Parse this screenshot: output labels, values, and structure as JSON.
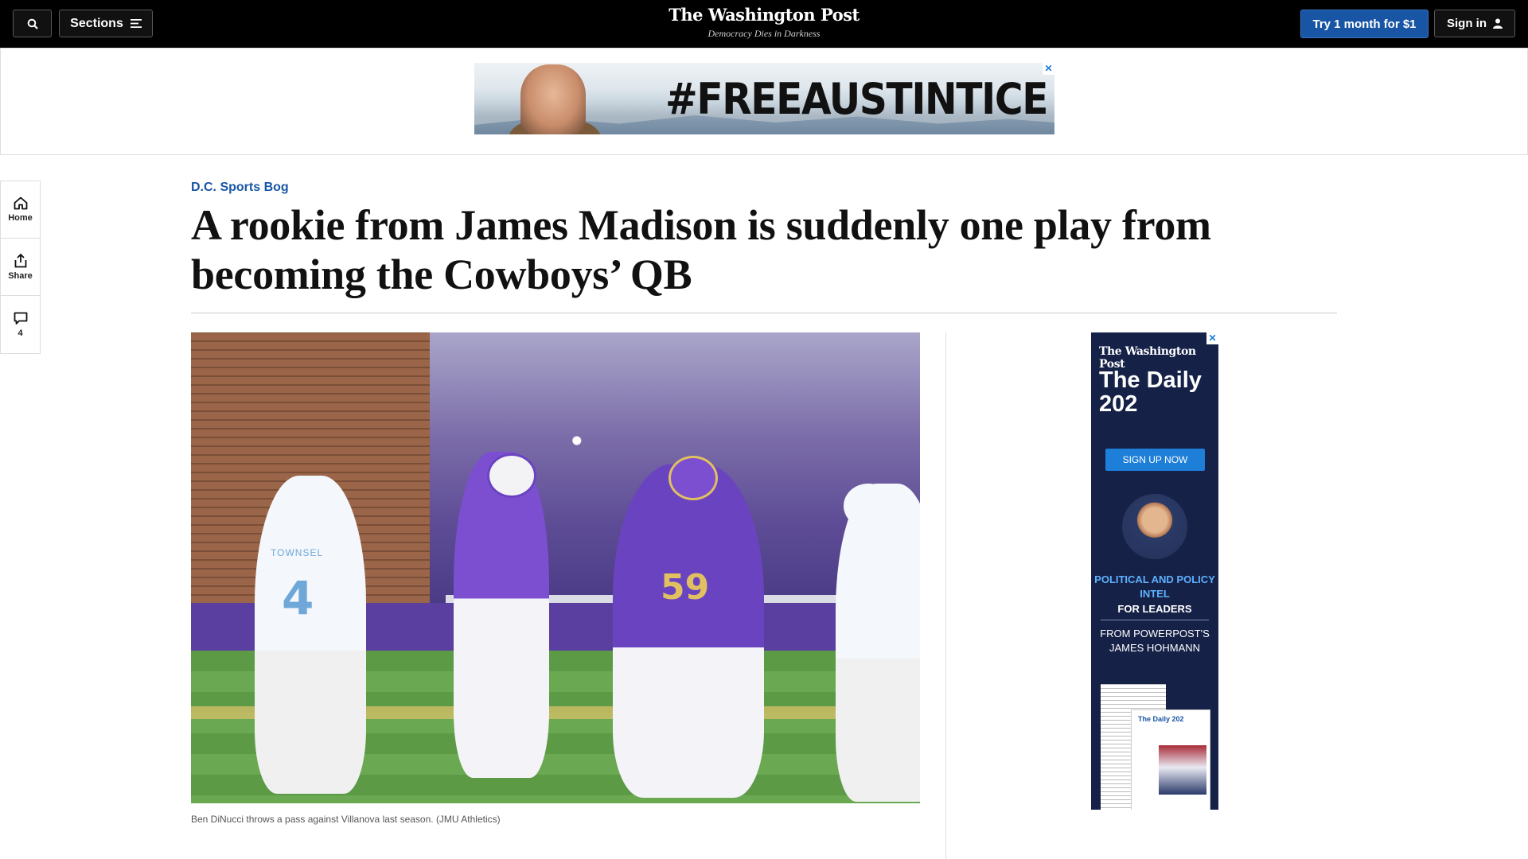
{
  "header": {
    "logo": "The Washington Post",
    "tagline": "Democracy Dies in Darkness",
    "sections_label": "Sections",
    "try_label": "Try 1 month for $1",
    "sign_in_label": "Sign in",
    "search_icon": "search-icon",
    "menu_icon": "hamburger-icon",
    "user_icon": "user-icon"
  },
  "top_ad": {
    "text": "#FREEAUSTINTICE",
    "close": "✕"
  },
  "rail": {
    "items": [
      {
        "label": "Home",
        "icon": "home-icon"
      },
      {
        "label": "Share",
        "icon": "share-icon"
      },
      {
        "label": "4",
        "icon": "comment-icon"
      }
    ]
  },
  "article": {
    "kicker": "D.C. Sports Bog",
    "headline": "A rookie from James Madison is suddenly one play from becoming the Cowboys’ QB",
    "caption": "Ben DiNucci throws a pass against Villanova last season. (JMU Athletics)"
  },
  "photo": {
    "number_left": "4",
    "name_left": "TOWNSEL",
    "number_right": "59"
  },
  "side_ad": {
    "logo": "The Washington Post",
    "title": "The Daily 202",
    "button": "SIGN UP NOW",
    "intel": "POLITICAL AND POLICY INTEL",
    "leaders": "FOR LEADERS",
    "from": "FROM POWERPOST'S JAMES HOHMANN",
    "doc_title": "The Daily 202",
    "close": "✕"
  },
  "colors": {
    "topbar": "#000000",
    "accent_blue": "#1955a5",
    "ad_navy": "#152147"
  }
}
